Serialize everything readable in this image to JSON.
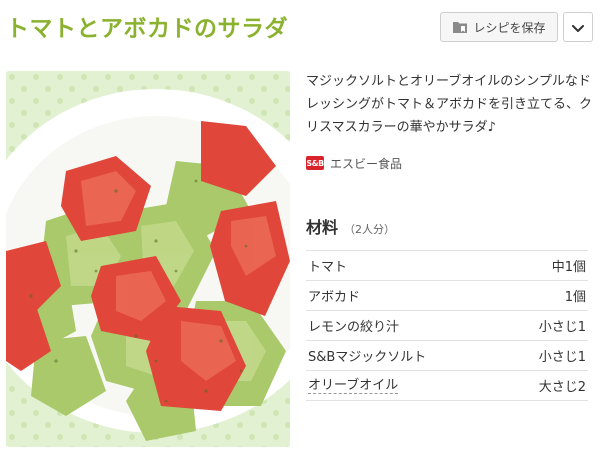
{
  "recipe": {
    "title": "トマトとアボカドのサラダ",
    "description": "マジックソルトとオリーブオイルのシンプルなドレッシングがトマト＆アボカドを引き立てる、クリスマスカラーの華やかサラダ♪",
    "brand_logo": "S&B",
    "author": "エスビー食品"
  },
  "actions": {
    "save_label": "レシピを保存",
    "save_icon": "bookmark-folder-icon",
    "menu_icon": "chevron-down-icon"
  },
  "ingredients": {
    "title": "材料",
    "serving": "（2人分）",
    "items": [
      {
        "name": "トマト",
        "amount": "中1個"
      },
      {
        "name": "アボカド",
        "amount": "1個"
      },
      {
        "name": "レモンの絞り汁",
        "amount": "小さじ1"
      },
      {
        "name": "S&Bマジックソルト",
        "amount": "小さじ1"
      },
      {
        "name": "オリーブオイル",
        "amount": "大さじ2"
      }
    ]
  },
  "colors": {
    "title_green": "#8ab22f",
    "brand_red": "#d8232a"
  }
}
